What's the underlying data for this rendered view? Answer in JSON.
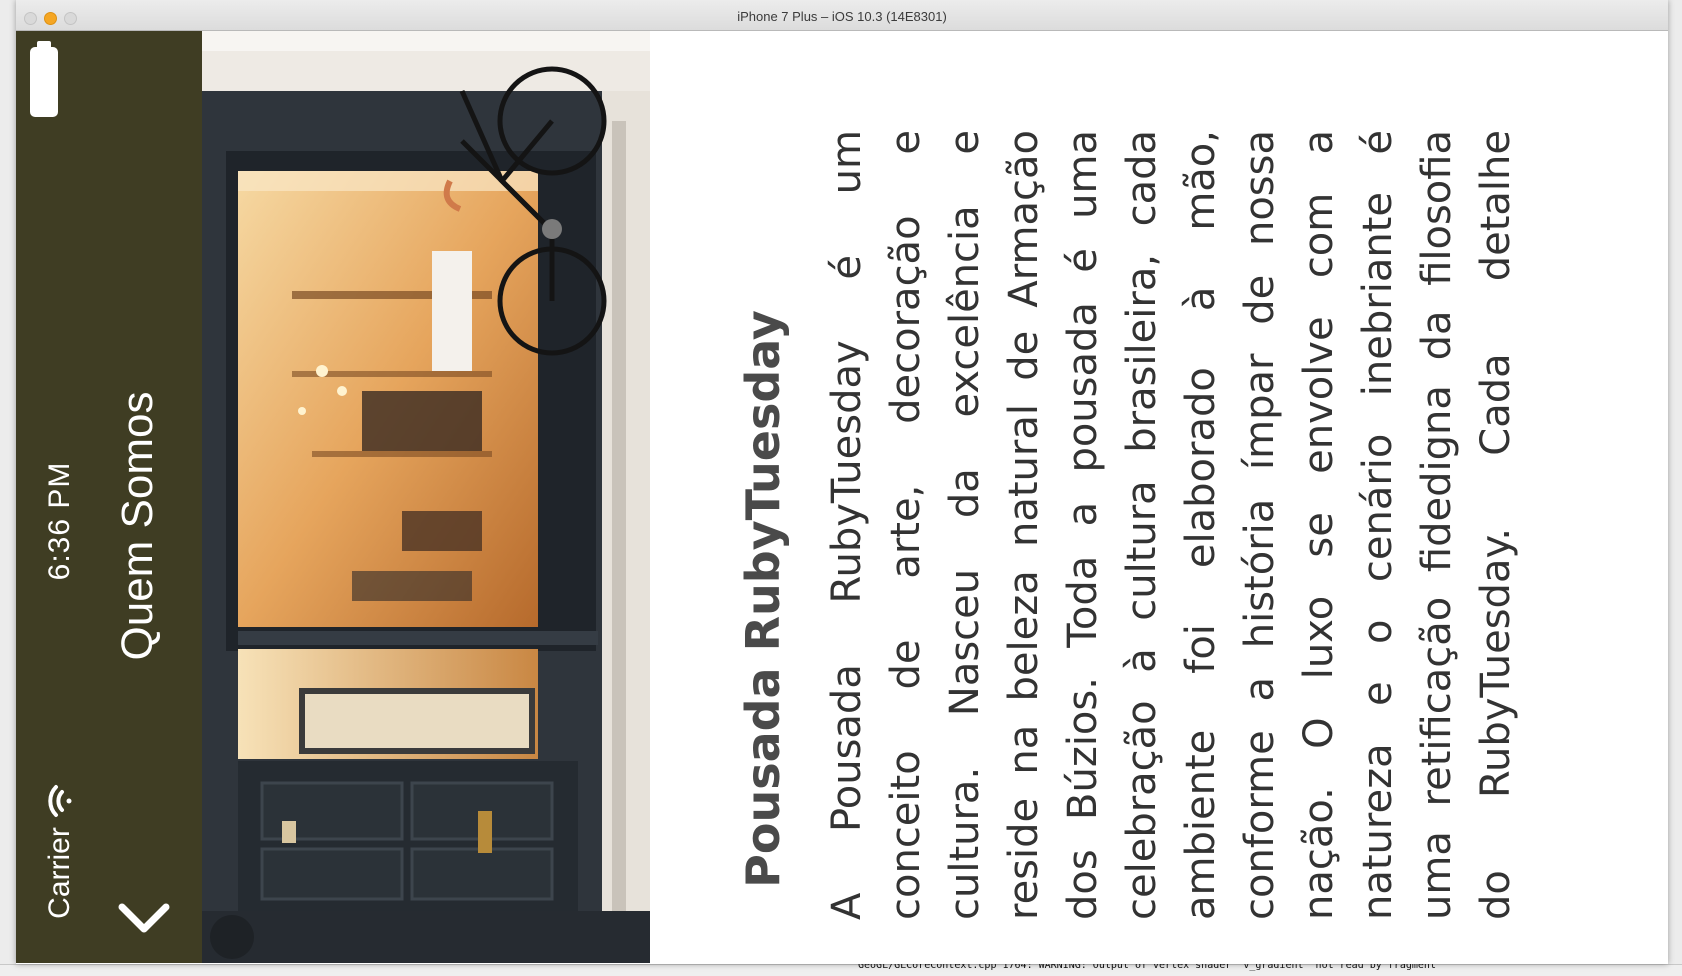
{
  "window": {
    "title": "iPhone 7 Plus – iOS 10.3 (14E8301)"
  },
  "status_bar": {
    "time": "6:36 PM",
    "carrier": "Carrier"
  },
  "nav": {
    "title": "Quem Somos"
  },
  "content": {
    "heading": "Pousada RubyTuesday",
    "lines": [
      "A Pousada RubyTuesday é um",
      "conceito de arte, decoração e",
      "cultura. Nasceu da excelência e",
      "reside na beleza natural de Armação",
      "dos Búzios. Toda a pousada é uma",
      "celebração à cultura brasileira, cada",
      "ambiente foi elaborado à mão,",
      "conforme a história ímpar de nossa",
      "nação. O luxo se envolve com a",
      "natureza e o cenário inebriante é",
      "uma retificação fidedigna da filosofia",
      "do RubyTuesday. Cada detalhe"
    ]
  },
  "console": {
    "message": "GeoGL/GLCoreContext.cpp 1764: WARNING: Output of vertex shader 'v_gradient' not read by fragment"
  },
  "colors": {
    "nav_background": "#3f3d23",
    "text": "#333333",
    "heading": "#4a4a4a"
  }
}
